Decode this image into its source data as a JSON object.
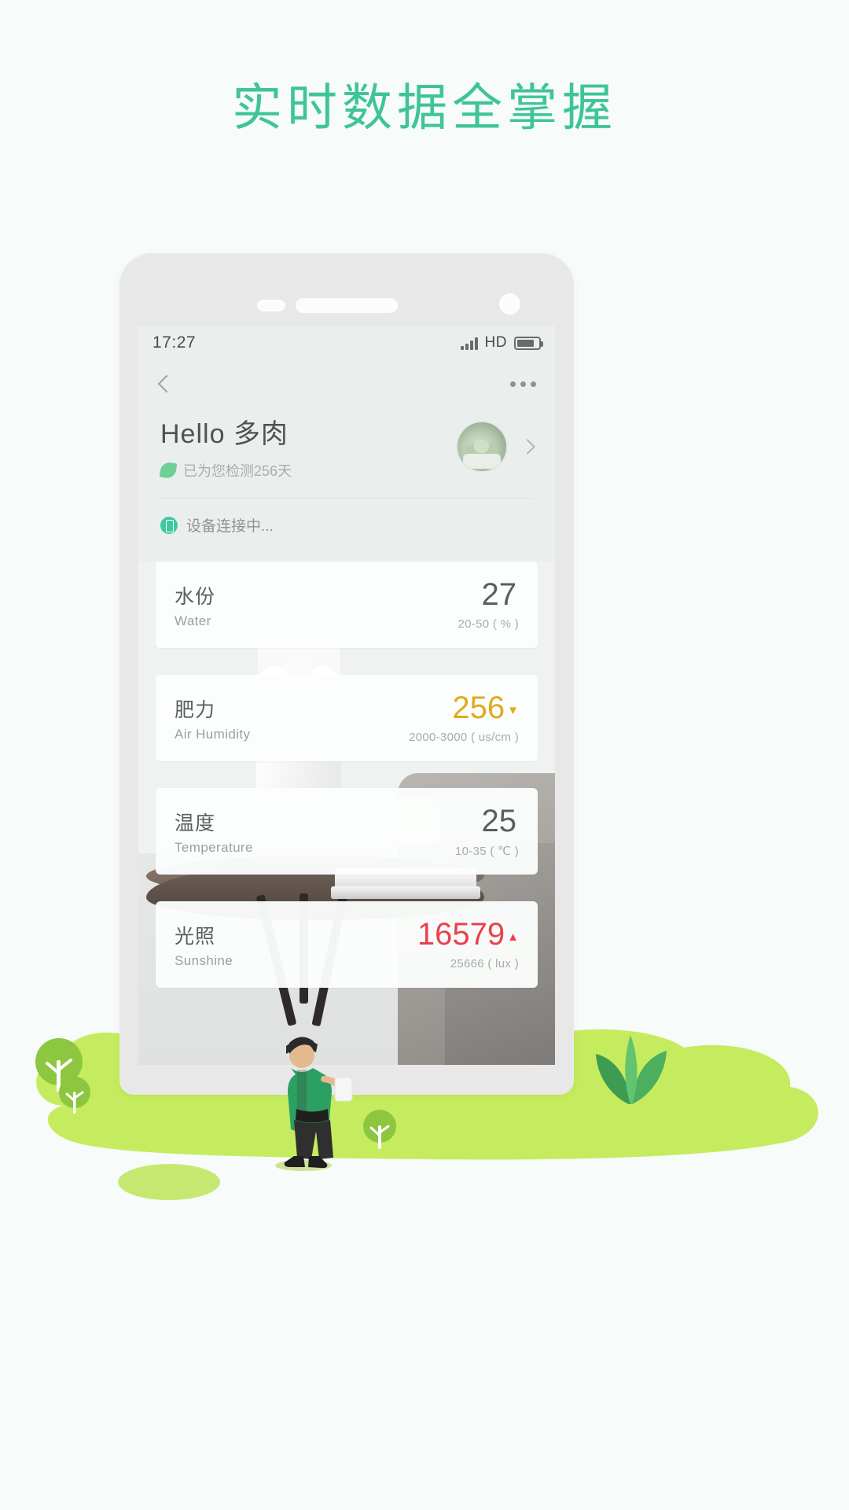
{
  "page": {
    "headline": "实时数据全掌握",
    "accent_color": "#3fc49a"
  },
  "phone": {
    "status_bar": {
      "time": "17:27",
      "signal_icon": "signal-bars-icon",
      "network_label": "HD",
      "battery_icon": "battery-icon"
    },
    "nav": {
      "back_icon": "back-chevron-icon",
      "more_icon": "more-options-icon"
    },
    "header": {
      "greeting": "Hello 多肉",
      "leaf_icon": "leaf-icon",
      "subtitle": "已为您检测256天",
      "avatar_icon": "plant-avatar",
      "arrow_icon": "chevron-right-icon"
    },
    "device": {
      "status_icon": "device-icon",
      "status_text": "设备连接中..."
    },
    "cards": [
      {
        "cn": "水份",
        "en": "Water",
        "value": "27",
        "range": "20-50 ( % )",
        "trend": "",
        "state": "normal"
      },
      {
        "cn": "肥力",
        "en": "Air Humidity",
        "value": "256",
        "range": "2000-3000 ( us/cm )",
        "trend": "▼",
        "state": "warn"
      },
      {
        "cn": "温度",
        "en": "Temperature",
        "value": "25",
        "range": "10-35 ( ℃ )",
        "trend": "",
        "state": "normal"
      },
      {
        "cn": "光照",
        "en": "Sunshine",
        "value": "16579",
        "range": "25666 ( lux )",
        "trend": "▲",
        "state": "alert"
      }
    ]
  },
  "decoration": {
    "grass_color": "#c5ec5e",
    "tree_color": "#8dc63f",
    "worker_icon": "worker-figure",
    "plant_icon": "aloe-plant"
  }
}
